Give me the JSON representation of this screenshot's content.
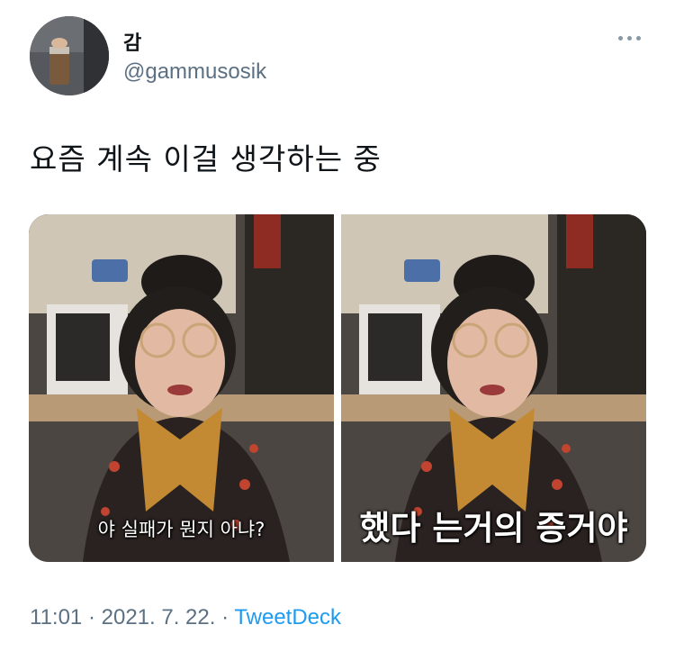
{
  "user": {
    "display_name": "감",
    "handle": "@gammusosik"
  },
  "tweet": {
    "text": "요즘 계속 이걸 생각하는 중"
  },
  "media": {
    "images": [
      {
        "caption": "야 실패가 뭔지 아냐?"
      },
      {
        "caption": "했다 는거의 증거야"
      }
    ]
  },
  "meta": {
    "time": "11:01",
    "separator1": "·",
    "date": "2021. 7. 22.",
    "separator2": "·",
    "source": "TweetDeck"
  },
  "icons": {
    "more": "more-horizontal-icon"
  },
  "colors": {
    "text": "#0f1419",
    "secondary": "#5b7083",
    "link": "#1d9bf0"
  }
}
